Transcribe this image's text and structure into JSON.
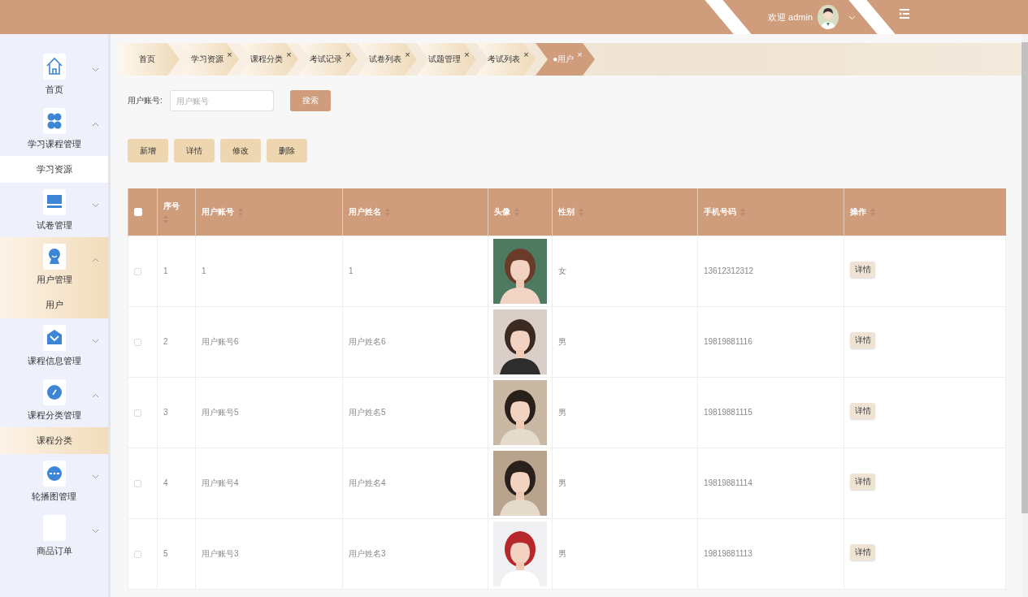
{
  "header": {
    "welcome": "欢迎 admin",
    "expanded": false
  },
  "sidebar": {
    "items": [
      {
        "label": "首页",
        "expanded": false,
        "selected": false
      },
      {
        "label": "学习课程管理",
        "expanded": true,
        "selected": false,
        "children": [
          {
            "label": "学习资源",
            "selected": false
          }
        ]
      },
      {
        "label": "试卷管理",
        "expanded": false,
        "selected": false
      },
      {
        "label": "用户管理",
        "expanded": true,
        "selected": true,
        "children": [
          {
            "label": "用户",
            "selected": true
          }
        ]
      },
      {
        "label": "课程信息管理",
        "expanded": false,
        "selected": false
      },
      {
        "label": "课程分类管理",
        "expanded": true,
        "selected": false,
        "children": [
          {
            "label": "课程分类",
            "selected": false,
            "hovered": true
          }
        ]
      },
      {
        "label": "轮播图管理",
        "expanded": false,
        "selected": false
      },
      {
        "label": "商品订单",
        "expanded": false,
        "selected": false
      }
    ]
  },
  "tabs": [
    {
      "label": "首页",
      "selected": false
    },
    {
      "label": "学习资源",
      "close": "×",
      "selected": false
    },
    {
      "label": "课程分类",
      "close": "×",
      "selected": false
    },
    {
      "label": "考试记录",
      "close": "×",
      "selected": false
    },
    {
      "label": "试卷列表",
      "close": "×",
      "selected": false
    },
    {
      "label": "试题管理",
      "close": "×",
      "selected": false
    },
    {
      "label": "考试列表",
      "close": "×",
      "selected": false
    },
    {
      "label": "●用户",
      "close": "×",
      "selected": true
    }
  ],
  "search": {
    "label": "用户账号:",
    "placeholder": "用户账号",
    "button": "搜索"
  },
  "actions": [
    "新增",
    "详情",
    "修改",
    "删除"
  ],
  "table": {
    "select_all_checked": false,
    "columns": [
      {
        "label": "序号"
      },
      {
        "label": "用户账号"
      },
      {
        "label": "用户姓名"
      },
      {
        "label": "头像"
      },
      {
        "label": "性别"
      },
      {
        "label": "手机号码"
      },
      {
        "label": "操作"
      }
    ],
    "rows": [
      {
        "checked": false,
        "index": "1",
        "account": "1",
        "name": "1",
        "gender": "女",
        "phone": "13612312312",
        "action": "详情"
      },
      {
        "checked": false,
        "index": "2",
        "account": "用户账号6",
        "name": "用户姓名6",
        "gender": "男",
        "phone": "19819881116",
        "action": "详情"
      },
      {
        "checked": false,
        "index": "3",
        "account": "用户账号5",
        "name": "用户姓名5",
        "gender": "男",
        "phone": "19819881115",
        "action": "详情"
      },
      {
        "checked": false,
        "index": "4",
        "account": "用户账号4",
        "name": "用户姓名4",
        "gender": "男",
        "phone": "19819881114",
        "action": "详情"
      },
      {
        "checked": false,
        "index": "5",
        "account": "用户账号3",
        "name": "用户姓名3",
        "gender": "男",
        "phone": "19819881113",
        "action": "详情"
      }
    ]
  }
}
